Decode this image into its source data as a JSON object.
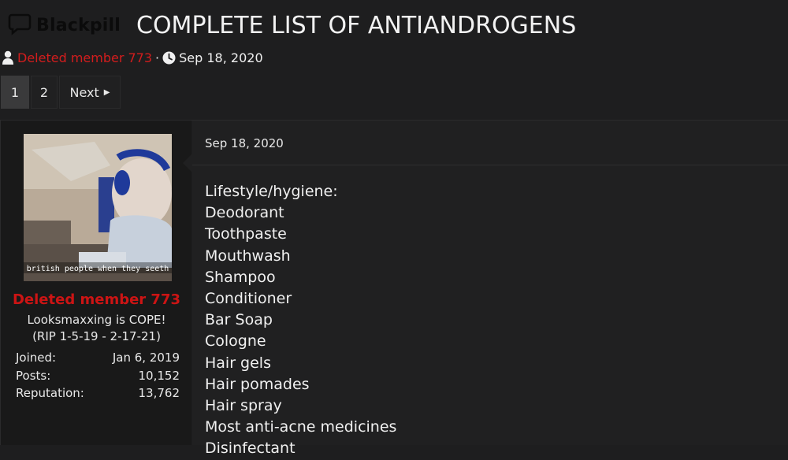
{
  "site": {
    "logo_text": "Blackpill",
    "logo_icon": "speech-bubble-icon"
  },
  "thread": {
    "title": "COMPLETE LIST OF ANTIANDROGENS"
  },
  "meta": {
    "author": "Deleted member 773",
    "separator": "·",
    "date": "Sep 18, 2020"
  },
  "pagination": {
    "pages": [
      "1",
      "2"
    ],
    "current": "1",
    "next_label": "Next"
  },
  "post": {
    "user": {
      "avatar_caption": "british people when they seeth",
      "name": "Deleted member 773",
      "title": "Looksmaxxing is COPE! (RIP 1-5-19 - 2-17-21)",
      "stats": [
        {
          "label": "Joined:",
          "value": "Jan 6, 2019"
        },
        {
          "label": "Posts:",
          "value": "10,152"
        },
        {
          "label": "Reputation:",
          "value": "13,762"
        }
      ]
    },
    "date": "Sep 18, 2020",
    "lines": [
      "Lifestyle/hygiene:",
      "Deodorant",
      "Toothpaste",
      "Mouthwash",
      "Shampoo",
      "Conditioner",
      "Bar Soap",
      "Cologne",
      "Hair gels",
      "Hair pomades",
      "Hair spray",
      "Most anti-acne medicines",
      "Disinfectant"
    ]
  },
  "colors": {
    "background": "#1e1e1f",
    "author_red": "#d31d1d",
    "username_red": "#cc1414"
  }
}
